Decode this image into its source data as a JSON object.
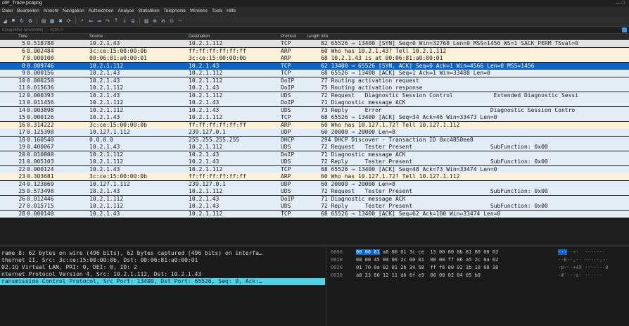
{
  "window": {
    "title": "oIP_Trace.pcapng",
    "controls": "— □"
  },
  "menu": [
    "Datei",
    "Bearbeiten",
    "Ansicht",
    "Navigation",
    "Aufzeichnen",
    "Analyse",
    "Statistiken",
    "Telephonie",
    "Wireless",
    "Tools",
    "Hilfe"
  ],
  "toolbar_icons": [
    "shark-fin-icon",
    "stop-icon",
    "restart-icon",
    "options-icon",
    "open-file-icon",
    "save-icon",
    "close-file-icon",
    "reload-icon",
    "find-icon",
    "back-icon",
    "forward-icon",
    "goto-icon",
    "first-icon",
    "last-icon",
    "autoscroll-icon",
    "colorize-icon",
    "zoom-in-icon",
    "zoom-out-icon",
    "zoom-reset-icon",
    "resize-columns-icon"
  ],
  "filter": {
    "placeholder": "nzeigefilter anwenden … <Ctrl-/>"
  },
  "columns": {
    "time": "Time",
    "source": "Source",
    "destination": "Destination",
    "protocol": "Protocol",
    "length_info": "Length Info"
  },
  "rows": [
    {
      "no": "5",
      "time": "0.518788",
      "src": "10.2.1.43",
      "dst": "10.2.1.112",
      "proto": "TCP",
      "info": "82 65526 → 13400 [SYN] Seq=0 Win=32768 Len=0 MSS=1456 WS=1 SACK_PERM TSval=0",
      "kind": "gray"
    },
    {
      "no": "6",
      "time": "0.002484",
      "src": "3c:ce:15:00:00:0b",
      "dst": "ff:ff:ff:ff:ff:ff",
      "proto": "ARP",
      "info": "60 Who has 10.2.1.43? Tell 10.2.1.112",
      "kind": "arp"
    },
    {
      "no": "7",
      "time": "0.000108",
      "src": "00:06:81:a0:00:01",
      "dst": "3c:ce:15:00:00:0b",
      "proto": "ARP",
      "info": "68 10.2.1.43 is at 00:06:81:a0:00:01",
      "kind": "arp"
    },
    {
      "no": "8",
      "time": "0.009746",
      "src": "10.2.1.112",
      "dst": "10.2.1.43",
      "proto": "TCP",
      "info": "62 13400 → 65526 [SYN, ACK] Seq=0 Ack=1 Win=4566 Len=0 MSS=1456",
      "kind": "sel"
    },
    {
      "no": "9",
      "time": "0.000156",
      "src": "10.2.1.43",
      "dst": "10.2.1.112",
      "proto": "TCP",
      "info": "68 65526 → 13400 [ACK] Seq=1 Ack=1 Win=33488 Len=0",
      "kind": "tcp"
    },
    {
      "no": "10",
      "time": "0.000250",
      "src": "10.2.1.43",
      "dst": "10.2.1.112",
      "proto": "DoIP",
      "info": "77 Routing activation request",
      "kind": "tcp"
    },
    {
      "no": "11",
      "time": "0.015636",
      "src": "10.2.1.112",
      "dst": "10.2.1.43",
      "proto": "DoIP",
      "info": "75 Routing activation response",
      "kind": "tcp"
    },
    {
      "no": "12",
      "time": "0.000393",
      "src": "10.2.1.43",
      "dst": "10.2.1.112",
      "proto": "UDS",
      "info": "72 Request   Diagnostic Session Control            Extended Diagnostic Sessi",
      "kind": "tcp"
    },
    {
      "no": "13",
      "time": "0.011456",
      "src": "10.2.1.112",
      "dst": "10.2.1.43",
      "proto": "DoIP",
      "info": "71 Diagnostic message ACK",
      "kind": "tcp"
    },
    {
      "no": "14",
      "time": "0.003898",
      "src": "10.2.1.112",
      "dst": "10.2.1.43",
      "proto": "UDS",
      "info": "73 Reply     Error                                Diagnostic Session Contro",
      "kind": "tcp"
    },
    {
      "no": "15",
      "time": "0.000126",
      "src": "10.2.1.43",
      "dst": "10.2.1.112",
      "proto": "TCP",
      "info": "68 65526 → 13400 [ACK] Seq=34 Ack=46 Win=33473 Len=0",
      "kind": "tcp"
    },
    {
      "no": "16",
      "time": "0.314222",
      "src": "3c:ce:15:00:00:0b",
      "dst": "ff:ff:ff:ff:ff:ff",
      "proto": "ARP",
      "info": "60 Who has 10.127.1.72? Tell 10.127.1.112",
      "kind": "arp"
    },
    {
      "no": "17",
      "time": "0.125398",
      "src": "10.127.1.112",
      "dst": "239.127.0.1",
      "proto": "UDP",
      "info": "60 20000 → 20000 Len=8",
      "kind": "udp"
    },
    {
      "no": "18",
      "time": "0.160540",
      "src": "0.0.0.0",
      "dst": "255.255.255.255",
      "proto": "DHCP",
      "info": "294 DHCP Discover - Transaction ID 0xc4858ee8",
      "kind": "udp"
    },
    {
      "no": "19",
      "time": "0.400067",
      "src": "10.2.1.43",
      "dst": "10.2.1.112",
      "proto": "UDS",
      "info": "72 Request   Tester Present                       SubFunction: 0x00",
      "kind": "tcp"
    },
    {
      "no": "20",
      "time": "0.010800",
      "src": "10.2.1.112",
      "dst": "10.2.1.43",
      "proto": "DoIP",
      "info": "71 Diagnostic message ACK",
      "kind": "tcp"
    },
    {
      "no": "21",
      "time": "0.005103",
      "src": "10.2.1.112",
      "dst": "10.2.1.43",
      "proto": "UDS",
      "info": "72 Reply     Tester Present                       SubFunction: 0x00",
      "kind": "tcp"
    },
    {
      "no": "22",
      "time": "0.000124",
      "src": "10.2.1.43",
      "dst": "10.2.1.112",
      "proto": "TCP",
      "info": "68 65526 → 13400 [ACK] Seq=48 Ack=73 Win=33474 Len=0",
      "kind": "tcp"
    },
    {
      "no": "23",
      "time": "0.303681",
      "src": "3c:ce:15:00:00:0b",
      "dst": "ff:ff:ff:ff:ff:ff",
      "proto": "ARP",
      "info": "60 Who has 10.127.1.72? Tell 10.127.1.112",
      "kind": "arp"
    },
    {
      "no": "24",
      "time": "0.123069",
      "src": "10.127.1.112",
      "dst": "239.127.0.1",
      "proto": "UDP",
      "info": "60 20000 → 20000 Len=8",
      "kind": "udp"
    },
    {
      "no": "25",
      "time": "0.573498",
      "src": "10.2.1.43",
      "dst": "10.2.1.112",
      "proto": "UDS",
      "info": "72 Request   Tester Present                       SubFunction: 0x00",
      "kind": "tcp"
    },
    {
      "no": "26",
      "time": "0.012446",
      "src": "10.2.1.112",
      "dst": "10.2.1.43",
      "proto": "DoIP",
      "info": "71 Diagnostic message ACK",
      "kind": "tcp"
    },
    {
      "no": "27",
      "time": "0.015715",
      "src": "10.2.1.112",
      "dst": "10.2.1.43",
      "proto": "UDS",
      "info": "72 Reply     Tester Present                       SubFunction: 0x00",
      "kind": "tcp"
    },
    {
      "no": "28",
      "time": "0.000140",
      "src": "10.2.1.43",
      "dst": "10.2.1.112",
      "proto": "TCP",
      "info": "68 65526 → 13400 [ACK] Seq=62 Ack=100 Win=33474 Len=0",
      "kind": "tcp"
    }
  ],
  "details": [
    {
      "text": "rame 8: 62 bytes on wire (496 bits), 62 bytes captured (496 bits) on interfa…",
      "selected": false
    },
    {
      "text": "thernet II, Src: 3c:ce:15:00:00:0b, Dst: 00:06:81:a0:00:01",
      "selected": false
    },
    {
      "text": "02.1Q Virtual LAN, PRI: 0, DEI: 0, ID: 2",
      "selected": false
    },
    {
      "text": "nternet Protocol Version 4, Src: 10.2.1.112, Dst: 10.2.1.43",
      "selected": false
    },
    {
      "text": "ransmission Control Protocol, Src Port: 13400, Dst Port: 65526, Seq: 0, Ack:…",
      "selected": true
    }
  ],
  "bytes": [
    {
      "offset": "0000",
      "hex_hl": "00 06 81",
      "hex": " a0 00 01 3c ce  15 00 00 0b 81 00 00 02",
      "ascii_hl": "···",
      "ascii": "··<·  ·······"
    },
    {
      "offset": "0010",
      "hex_hl": "",
      "hex": "08 00 45 00 00 2c 00 01  00 00 ff 06 a5 2c 0a 02",
      "ascii_hl": "",
      "ascii": "··E··,·· ·····,··"
    },
    {
      "offset": "0020",
      "hex_hl": "",
      "hex": "01 70 0a 02 01 2b 34 58  ff f6 00 02 1b 10 08 38",
      "ascii_hl": "",
      "ascii": "·p···+4X ·······8"
    },
    {
      "offset": "0030",
      "hex_hl": "",
      "hex": "a8 23 60 12 11 d6 6f e9  00 00 02 04 05 b0",
      "ascii_hl": "",
      "ascii": "·#`···o· ······"
    }
  ]
}
